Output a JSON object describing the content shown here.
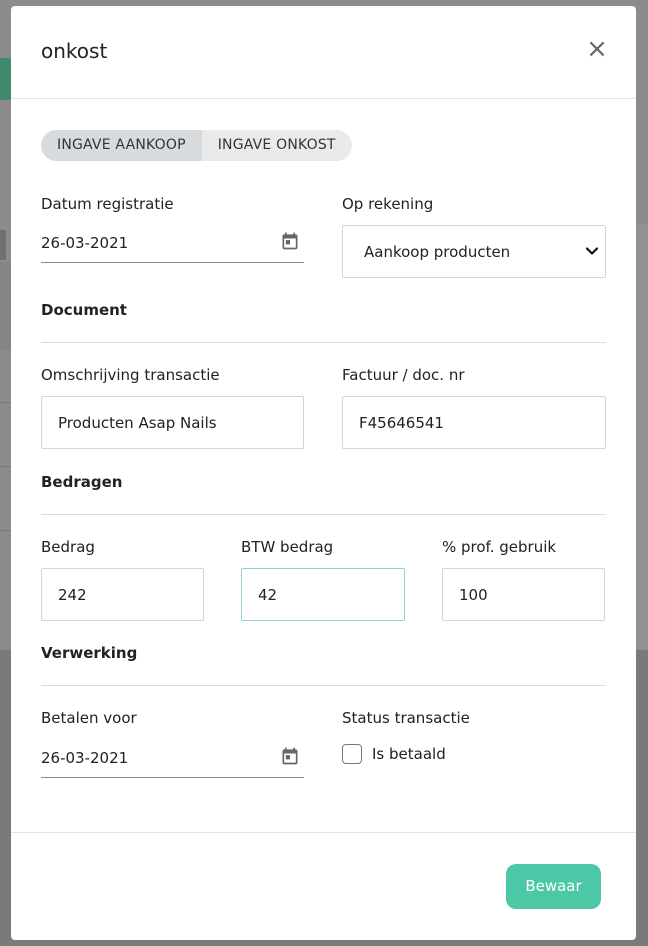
{
  "modal": {
    "title": "onkost",
    "close_symbol": "×"
  },
  "tabs": [
    {
      "label": "INGAVE AANKOOP",
      "active": true
    },
    {
      "label": "INGAVE ONKOST",
      "active": false
    }
  ],
  "fields": {
    "datum_registratie": {
      "label": "Datum registratie",
      "value": "26-03-2021",
      "icon": "calendar-icon"
    },
    "op_rekening": {
      "label": "Op rekening",
      "value": "Aankoop producten",
      "icon": "chevron-down-icon"
    }
  },
  "sections": {
    "document": "Document",
    "bedragen": "Bedragen",
    "verwerking": "Verwerking"
  },
  "document": {
    "omschrijving": {
      "label": "Omschrijving transactie",
      "value": "Producten Asap Nails"
    },
    "factuur": {
      "label": "Factuur / doc. nr",
      "value": "F45646541"
    }
  },
  "bedragen": {
    "bedrag": {
      "label": "Bedrag",
      "value": "242"
    },
    "btw_bedrag": {
      "label": "BTW bedrag",
      "value": "42"
    },
    "prof_gebruik": {
      "label": "% prof. gebruik",
      "value": "100"
    }
  },
  "verwerking": {
    "betalen_voor": {
      "label": "Betalen voor",
      "value": "26-03-2021",
      "icon": "calendar-icon"
    },
    "status": {
      "label": "Status transactie",
      "checkbox_label": "Is betaald",
      "checked": false
    }
  },
  "actions": {
    "save_label": "Bewaar"
  },
  "colors": {
    "accent": "#4dc8a6",
    "focus_border": "#8fd0d8",
    "active_tab": "#d8dbde"
  }
}
